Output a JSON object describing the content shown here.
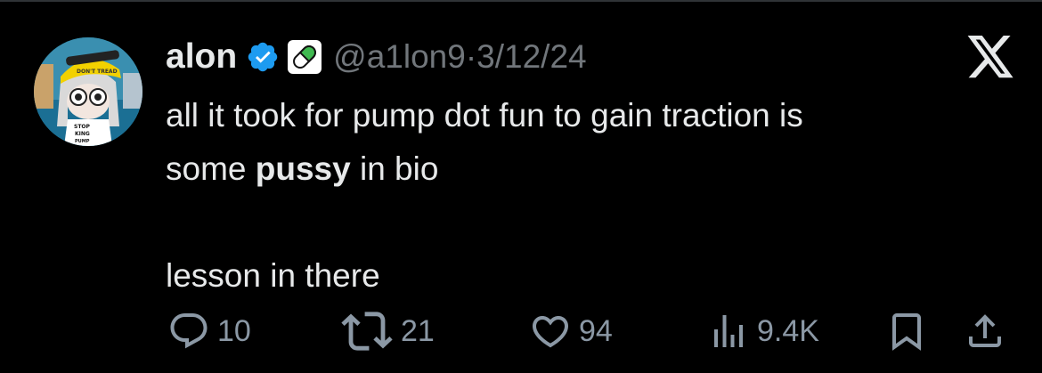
{
  "tweet": {
    "author": {
      "display_name": "alon",
      "handle": "@a1lon9",
      "verified_icon": "verified-badge-icon",
      "badge_icon": "pill-icon"
    },
    "date": "3/12/24",
    "meta_separator": " · ",
    "text": {
      "line1": "all it took for pump dot fun to gain traction is",
      "line2_prefix": "some ",
      "line2_bold": "pussy",
      "line2_suffix": " in bio",
      "line3": "lesson in there"
    },
    "avatar": {
      "hat_text": "DON'T TREAD",
      "shirt_text_1": "STOP",
      "shirt_text_2": "KING",
      "shirt_text_3": "PUMP"
    }
  },
  "actions": {
    "reply": {
      "icon": "reply-icon",
      "count": "10"
    },
    "repost": {
      "icon": "repost-icon",
      "count": "21"
    },
    "like": {
      "icon": "heart-icon",
      "count": "94"
    },
    "views": {
      "icon": "views-icon",
      "count": "9.4K"
    },
    "bookmark": {
      "icon": "bookmark-icon"
    },
    "share": {
      "icon": "share-icon"
    }
  },
  "colors": {
    "background": "#000000",
    "text": "#e7e9ea",
    "muted": "#71767b",
    "verified": "#1d9bf0",
    "pill": "#3fb950"
  }
}
